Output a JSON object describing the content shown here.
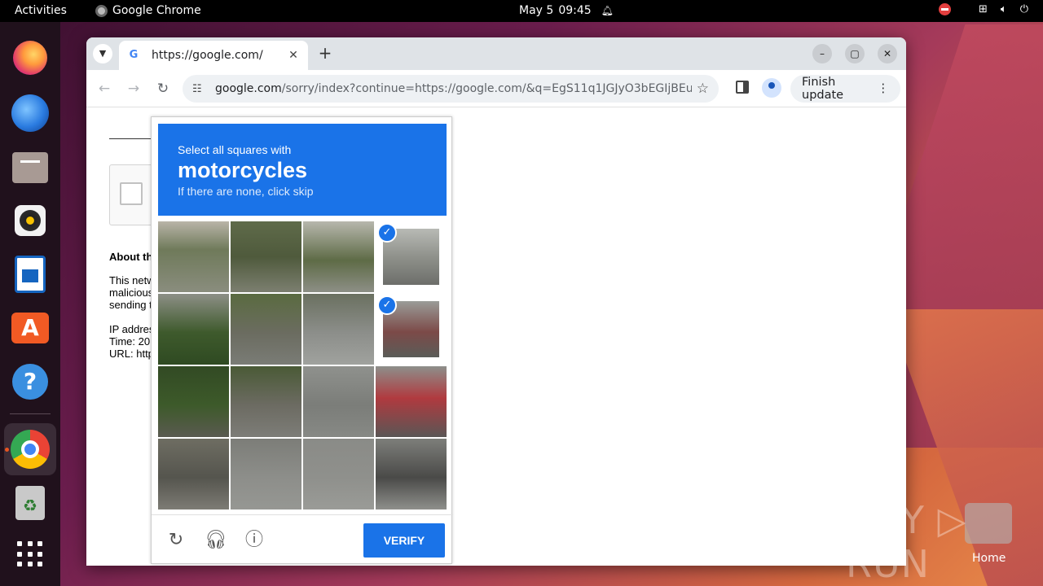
{
  "topbar": {
    "activities": "Activities",
    "app_name": "Google Chrome",
    "date": "May 5",
    "time": "09:45"
  },
  "dock": {
    "items": [
      "Firefox",
      "Thunderbird",
      "Files",
      "Rhythmbox",
      "LibreOffice Writer",
      "Ubuntu Software",
      "Help",
      "Google Chrome",
      "Trash",
      "Show Applications"
    ]
  },
  "browser": {
    "tab_title": "https://google.com/",
    "tab_favicon": "G",
    "url_domain": "google.com",
    "url_path": "/sorry/index?continue=https://google.com/&q=EgS11q1JGJyO3bEGIjBEu0tTG-...",
    "finish_update": "Finish update"
  },
  "page": {
    "about_heading": "About th",
    "para1": [
      "This netw",
      "malicious",
      "sending t"
    ],
    "para2": [
      "IP addres",
      "Time: 20",
      "URL: http"
    ]
  },
  "captcha": {
    "instruction": "Select all squares with",
    "target": "motorcycles",
    "hint": "If there are none, click skip",
    "verify_label": "VERIFY",
    "selected_tiles": [
      3,
      7
    ],
    "accent": "#1a73e8"
  },
  "desktop": {
    "watermark": "ANY RUN",
    "home_label": "Home"
  }
}
